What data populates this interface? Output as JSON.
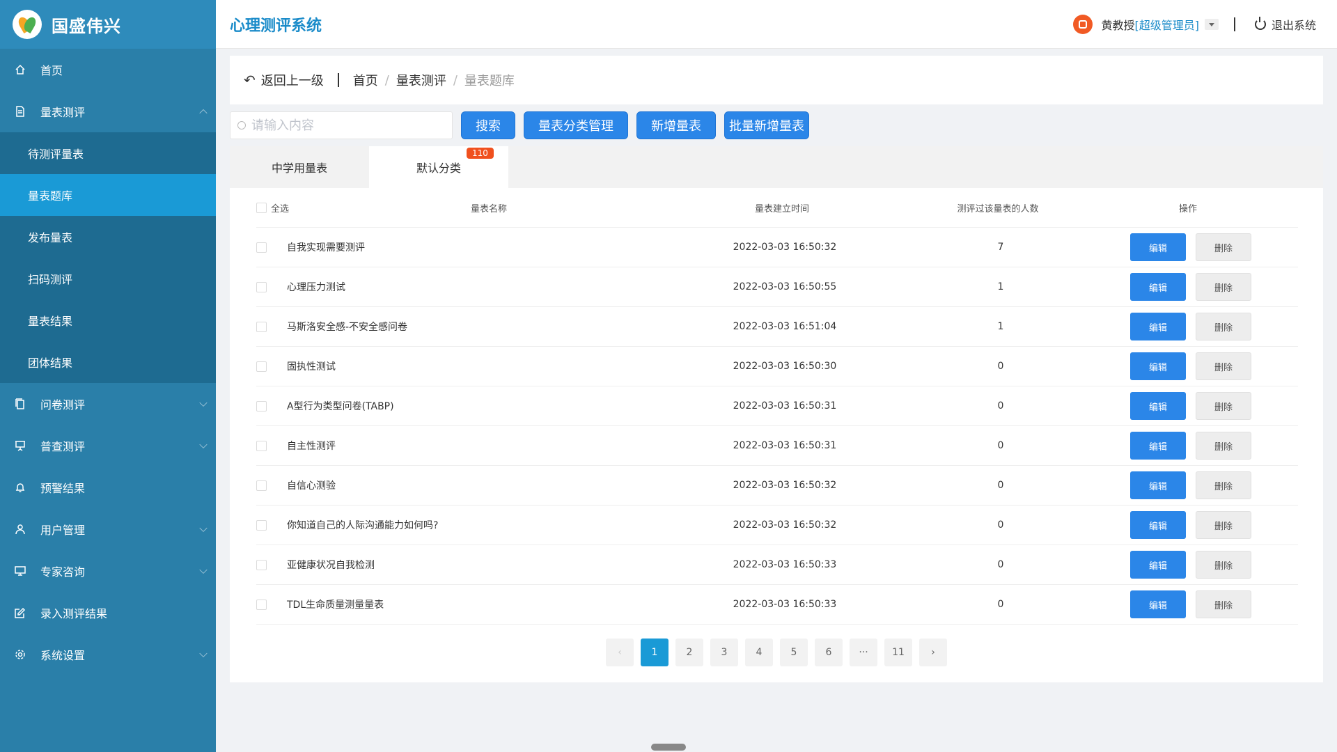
{
  "brand": {
    "name": "国盛伟兴"
  },
  "sidebar": {
    "items": [
      {
        "label": "首页",
        "icon": "home-icon"
      },
      {
        "label": "量表测评",
        "icon": "document-icon",
        "expanded": true,
        "children": [
          "待测评量表",
          "量表题库",
          "发布量表",
          "扫码测评",
          "量表结果",
          "团体结果"
        ],
        "active_child": "量表题库"
      },
      {
        "label": "问卷测评",
        "icon": "copy-icon"
      },
      {
        "label": "普查测评",
        "icon": "presentation-icon"
      },
      {
        "label": "预警结果",
        "icon": "bell-icon"
      },
      {
        "label": "用户管理",
        "icon": "user-icon"
      },
      {
        "label": "专家咨询",
        "icon": "monitor-icon"
      },
      {
        "label": "录入测评结果",
        "icon": "edit-icon"
      },
      {
        "label": "系统设置",
        "icon": "gear-icon"
      }
    ]
  },
  "header": {
    "title": "心理测评系统",
    "user_name": "黄教授",
    "user_role": "[超级管理员]",
    "logout_label": "退出系统"
  },
  "breadcrumb": {
    "back_label": "返回上一级",
    "items": [
      "首页",
      "量表测评",
      "量表题库"
    ]
  },
  "toolbar": {
    "search_placeholder": "请输入内容",
    "search_label": "搜索",
    "category_label": "量表分类管理",
    "add_label": "新增量表",
    "batch_add_label": "批量新增量表"
  },
  "tabs": [
    {
      "label": "中学用量表"
    },
    {
      "label": "默认分类",
      "badge": "110",
      "active": true
    }
  ],
  "table": {
    "select_all": "全选",
    "columns": [
      "量表名称",
      "量表建立时间",
      "测评过该量表的人数",
      "操作"
    ],
    "edit_label": "编辑",
    "delete_label": "删除",
    "rows": [
      {
        "name": "自我实现需要测评",
        "time": "2022-03-03 16:50:32",
        "count": "7"
      },
      {
        "name": "心理压力测试",
        "time": "2022-03-03 16:50:55",
        "count": "1"
      },
      {
        "name": "马斯洛安全感-不安全感问卷",
        "time": "2022-03-03 16:51:04",
        "count": "1"
      },
      {
        "name": "固执性测试",
        "time": "2022-03-03 16:50:30",
        "count": "0"
      },
      {
        "name": "A型行为类型问卷(TABP)",
        "time": "2022-03-03 16:50:31",
        "count": "0"
      },
      {
        "name": "自主性测评",
        "time": "2022-03-03 16:50:31",
        "count": "0"
      },
      {
        "name": "自信心测验",
        "time": "2022-03-03 16:50:32",
        "count": "0"
      },
      {
        "name": "你知道自己的人际沟通能力如何吗?",
        "time": "2022-03-03 16:50:32",
        "count": "0"
      },
      {
        "name": "亚健康状况自我检测",
        "time": "2022-03-03 16:50:33",
        "count": "0"
      },
      {
        "name": "TDL生命质量测量量表",
        "time": "2022-03-03 16:50:33",
        "count": "0"
      }
    ]
  },
  "pagination": {
    "prev": "‹",
    "next": "›",
    "pages": [
      "1",
      "2",
      "3",
      "4",
      "5",
      "6",
      "···",
      "11"
    ],
    "current": "1"
  }
}
